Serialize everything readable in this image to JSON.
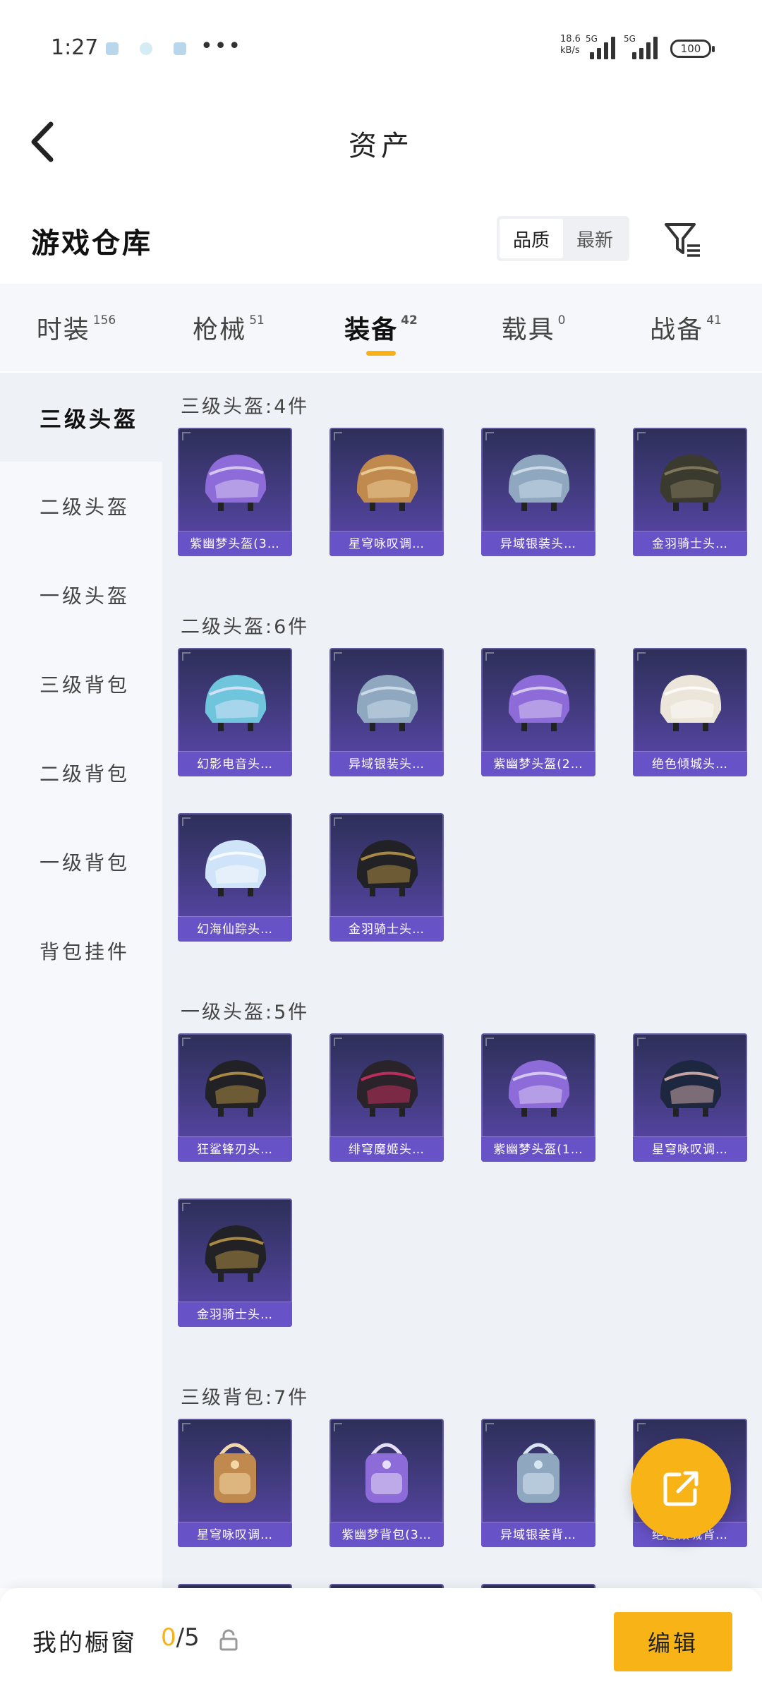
{
  "status_bar": {
    "time": "1:27",
    "more": "•••",
    "speed_value": "18.6",
    "speed_unit": "kB/s",
    "net1": "5G",
    "net2": "5G",
    "battery": "100"
  },
  "header": {
    "title": "资产"
  },
  "section": {
    "title": "游戏仓库",
    "sort_options": [
      "品质",
      "最新"
    ],
    "sort_active": 0
  },
  "tabs": [
    {
      "label": "时装",
      "count": "156"
    },
    {
      "label": "枪械",
      "count": "51"
    },
    {
      "label": "装备",
      "count": "42"
    },
    {
      "label": "载具",
      "count": "0"
    },
    {
      "label": "战备",
      "count": "41"
    }
  ],
  "active_tab": 2,
  "sidebar": {
    "items": [
      "三级头盔",
      "二级头盔",
      "一级头盔",
      "三级背包",
      "二级背包",
      "一级背包",
      "背包挂件"
    ],
    "active": 0
  },
  "groups": [
    {
      "title": "三级头盔:4件",
      "items": [
        {
          "label": "紫幽梦头盔(3…",
          "icon": "purple-flower-helmet-icon"
        },
        {
          "label": "星穹咏叹调…",
          "icon": "ornate-masked-helmet-icon"
        },
        {
          "label": "异域银装头…",
          "icon": "silver-visor-helmet-icon"
        },
        {
          "label": "金羽骑士头…",
          "icon": "dark-military-helmet-icon"
        }
      ]
    },
    {
      "title": "二级头盔:6件",
      "items": [
        {
          "label": "幻影电音头…",
          "icon": "headphone-helmet-icon"
        },
        {
          "label": "异域银装头…",
          "icon": "silver-helmet-icon"
        },
        {
          "label": "紫幽梦头盔(2…",
          "icon": "purple-flower-helmet-icon"
        },
        {
          "label": "绝色倾城头…",
          "icon": "white-helmet-icon"
        },
        {
          "label": "幻海仙踪头…",
          "icon": "iridescent-helmet-icon"
        },
        {
          "label": "金羽骑士头…",
          "icon": "black-gold-helmet-icon"
        }
      ]
    },
    {
      "title": "一级头盔:5件",
      "items": [
        {
          "label": "狂鲨锋刃头…",
          "icon": "black-shark-helmet-icon"
        },
        {
          "label": "绯穹魔姬头…",
          "icon": "red-black-helmet-icon"
        },
        {
          "label": "紫幽梦头盔(1…",
          "icon": "purple-round-helmet-icon"
        },
        {
          "label": "星穹咏叹调…",
          "icon": "winged-helmet-icon"
        },
        {
          "label": "金羽骑士头…",
          "icon": "black-gold-round-helmet-icon"
        }
      ]
    },
    {
      "title": "三级背包:7件",
      "items": [
        {
          "label": "星穹咏叹调…",
          "icon": "ornate-backpack-icon"
        },
        {
          "label": "紫幽梦背包(3…",
          "icon": "purple-backpack-icon"
        },
        {
          "label": "异域银装背…",
          "icon": "silver-backpack-icon"
        },
        {
          "label": "绝色倾城背…",
          "icon": "white-backpack-icon"
        },
        {
          "label": "",
          "icon": "crystal-backpack-icon"
        },
        {
          "label": "",
          "icon": "bunny-backpack-icon"
        },
        {
          "label": "",
          "icon": "military-backpack-icon"
        }
      ]
    }
  ],
  "fab": {
    "icon": "share-icon"
  },
  "bottom_bar": {
    "label": "我的橱窗",
    "current": "0",
    "total": "/5",
    "edit": "编辑"
  },
  "colors": {
    "accent": "#f7b21b",
    "card_top": "#2d2f58",
    "card_bottom": "#5d47b0",
    "card_label": "#6854c8",
    "content_bg": "#eef1f6",
    "sidebar_bg": "#f6f8fc"
  }
}
